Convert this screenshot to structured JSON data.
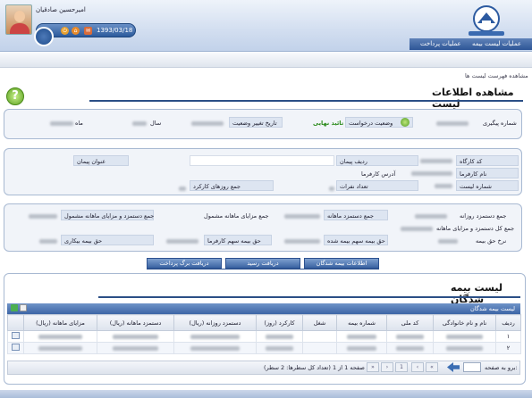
{
  "header": {
    "user_name": "امیرحسین صادقیان",
    "date": "1393/03/18",
    "nav": [
      "عملیات لیست بیمه",
      "عملیات پرداخت"
    ]
  },
  "breadcrumb": "مشاهده فهرست لیست ها",
  "page_title": "مشاهده اطلاعات لیست",
  "request": {
    "tracking_label": "شماره پیگیری",
    "status_label": "وضعیت درخواست",
    "status_value": "تائید نهایی",
    "status_date_label": "تاریخ تغییر وضعیت",
    "year_label": "سال",
    "month_label": "ماه"
  },
  "workshop": {
    "code_label": "کد کارگاه",
    "employer_label": "نام کارفرما",
    "list_no_label": "شماره لیست",
    "contract_row_label": "ردیف پیمان",
    "address_label": "آدرس کارفرما",
    "staff_count_label": "تعداد نفرات",
    "contract_title_label": "عنوان پیمان",
    "workdays_label": "جمع روزهای کارکرد"
  },
  "totals": {
    "daily_wage_label": "جمع دستمزد روزانه",
    "monthly_wage_label": "جمع دستمزد ماهانه",
    "monthly_benefits_label": "جمع مزایای ماهانه مشمول",
    "wage_benefits_label": "جمع دستمزد و مزایای ماهانه مشمول",
    "total_wage_benefits_label": "جمع کل دستمزد و مزایای ماهانه",
    "insurance_rate_label": "نرخ حق بیمه",
    "insured_share_label": "حق بیمه سهم بیمه شده",
    "employer_share_label": "حق بیمه سهم کارفرما",
    "unemployment_label": "حق بیمه بیکاری"
  },
  "tabs": [
    "اطلاعات بیمه شدگان",
    "دریافت رسید",
    "دریافت برگ پرداخت"
  ],
  "list": {
    "title": "لیست بیمه شدگان",
    "caption": "لیست بیمه شدگان",
    "columns": [
      "ردیف",
      "نام و نام خانوادگی",
      "کد ملی",
      "شماره بیمه",
      "شغل",
      "کارکرد (روز)",
      "دستمزد روزانه (ریال)",
      "دستمزد ماهانه (ریال)",
      "مزایای ماهانه (ریال)"
    ],
    "rows": [
      {
        "index": "۱"
      },
      {
        "index": "۲"
      }
    ]
  },
  "pager": {
    "go_label": "برو به صفحه:",
    "info": "صفحه 1 از 1 (تعداد کل سطرها: 2 سطر)",
    "current_page": "1"
  },
  "colors": {
    "accent": "#2b4f86",
    "status_ok": "#2a8a1a",
    "header_bg": "#d2def0"
  }
}
